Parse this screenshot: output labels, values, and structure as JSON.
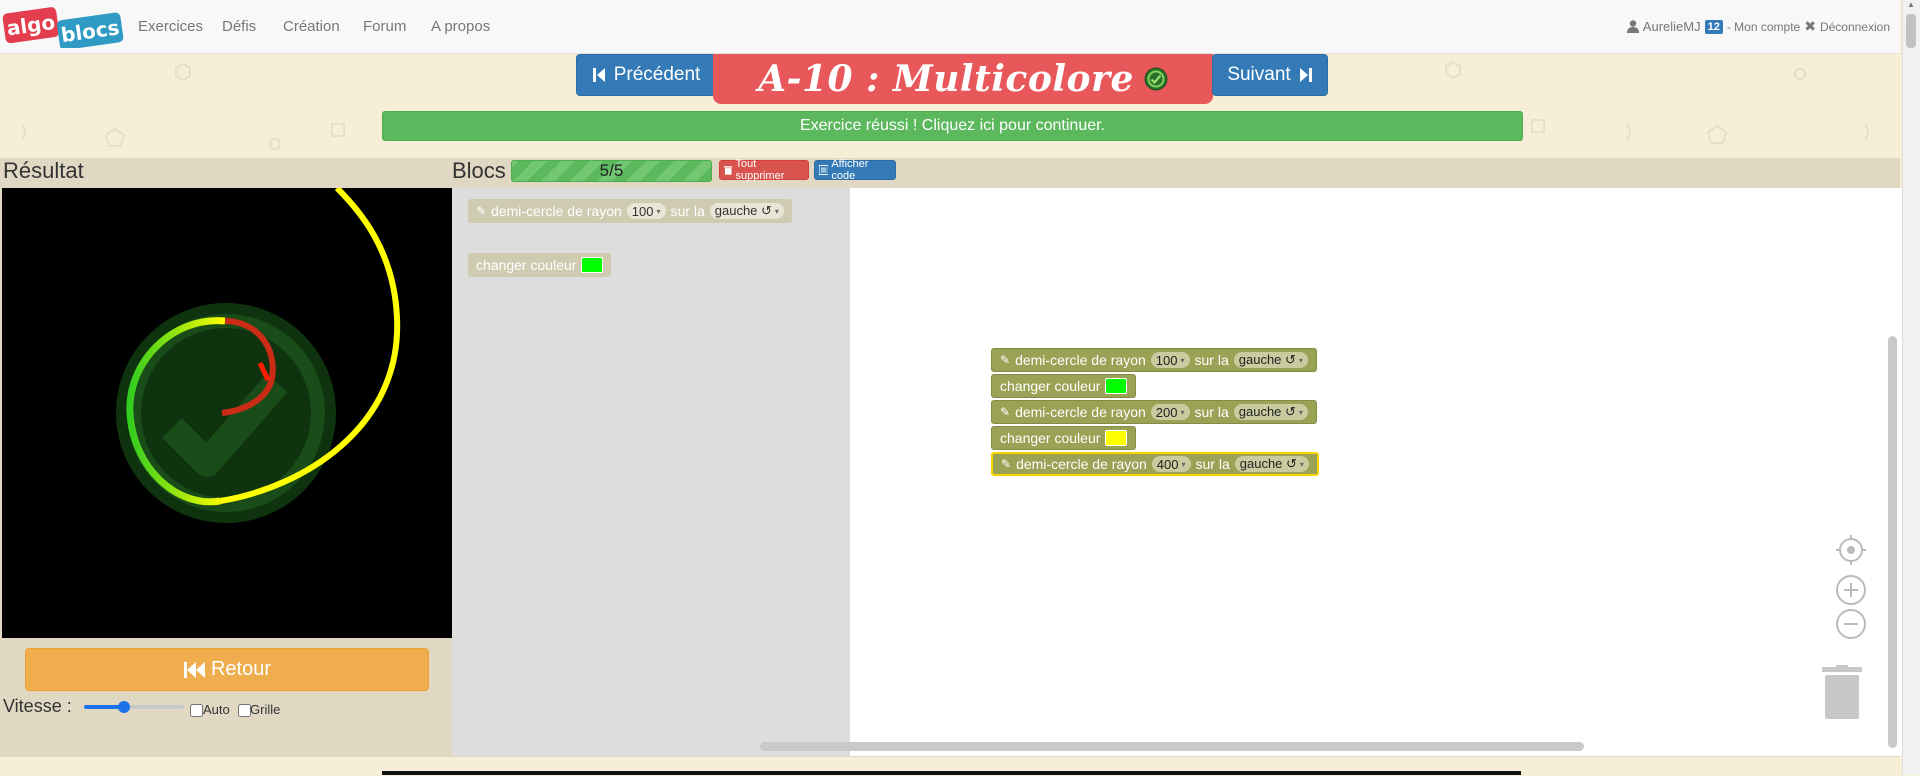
{
  "logo": {
    "part1": "algo",
    "part2": "blocs"
  },
  "nav": {
    "items": [
      {
        "label": "Exercices"
      },
      {
        "label": "Défis"
      },
      {
        "label": "Création"
      },
      {
        "label": "Forum"
      },
      {
        "label": "A propos"
      }
    ],
    "user": {
      "name": "AurelieMJ",
      "level": "12",
      "account": "- Mon compte",
      "logout": "Déconnexion"
    }
  },
  "exercise": {
    "prev_label": "Précédent",
    "next_label": "Suivant",
    "title": "A-10 : Multicolore",
    "success_message": "Exercice réussi ! Cliquez ici pour continuer."
  },
  "result": {
    "title": "Résultat",
    "back_label": "Retour",
    "speed_label": "Vitesse :",
    "speed_value": 0.4,
    "auto_label": "Auto",
    "auto_checked": false,
    "grid_label": "Grille",
    "grid_checked": false
  },
  "blocks": {
    "title": "Blocs",
    "progress": "5/5",
    "delete_all_label": "Tout supprimer",
    "show_code_label": "Afficher code",
    "toolbox": [
      {
        "type": "semicircle",
        "text": "demi-cercle de rayon",
        "radius": "100",
        "mid": "sur la",
        "direction": "gauche ↺"
      },
      {
        "type": "color",
        "text": "changer couleur",
        "color": "#00ff00"
      }
    ],
    "program": [
      {
        "type": "semicircle",
        "text": "demi-cercle de rayon",
        "radius": "100",
        "mid": "sur la",
        "direction": "gauche ↺"
      },
      {
        "type": "color",
        "text": "changer couleur",
        "color": "#00ff00"
      },
      {
        "type": "semicircle",
        "text": "demi-cercle de rayon",
        "radius": "200",
        "mid": "sur la",
        "direction": "gauche ↺"
      },
      {
        "type": "color",
        "text": "changer couleur",
        "color": "#ffff00"
      },
      {
        "type": "semicircle",
        "text": "demi-cercle de rayon",
        "radius": "400",
        "mid": "sur la",
        "direction": "gauche ↺"
      }
    ]
  },
  "colors": {
    "accent_blue": "#337ab7",
    "title_red": "#e8585a",
    "success_green": "#5cb85c",
    "retour_orange": "#f0ad4e",
    "block_olive": "#9aa255",
    "drawing_red": "#cc2b16",
    "drawing_green": "#33cc1f",
    "drawing_yellow": "#ffff00"
  }
}
